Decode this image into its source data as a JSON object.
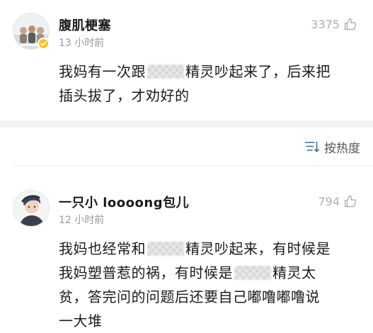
{
  "comments": [
    {
      "username": "腹肌梗塞",
      "time": "13 小时前",
      "likes": "3375",
      "verified": true,
      "avatar": "group-photo-avatar",
      "body_lines": [
        [
          "我妈有一次跟",
          "",
          "精灵吵起来了，后来把"
        ],
        [
          "插头拔了，才劝好的"
        ]
      ]
    },
    {
      "username": "一只小 loooong包儿",
      "time": "12 小时前",
      "likes": "794",
      "verified": false,
      "avatar": "cartoon-person-avatar",
      "body_lines": [
        [
          "我妈也经常和",
          "",
          "精灵吵起来，有时候是"
        ],
        [
          "我妈塑普惹的祸，有时候是",
          "",
          "精灵太"
        ],
        [
          "贫，答完问的问题后还要自己嘟噜嘟噜说"
        ],
        [
          "一大堆"
        ]
      ]
    }
  ],
  "sort": {
    "label": "按热度",
    "icon": "sort-icon"
  },
  "colors": {
    "text": "#1a1a1a",
    "muted": "#9a9a9a",
    "verified_badge": "#ffc21a",
    "separator": "#f2f2f2"
  }
}
